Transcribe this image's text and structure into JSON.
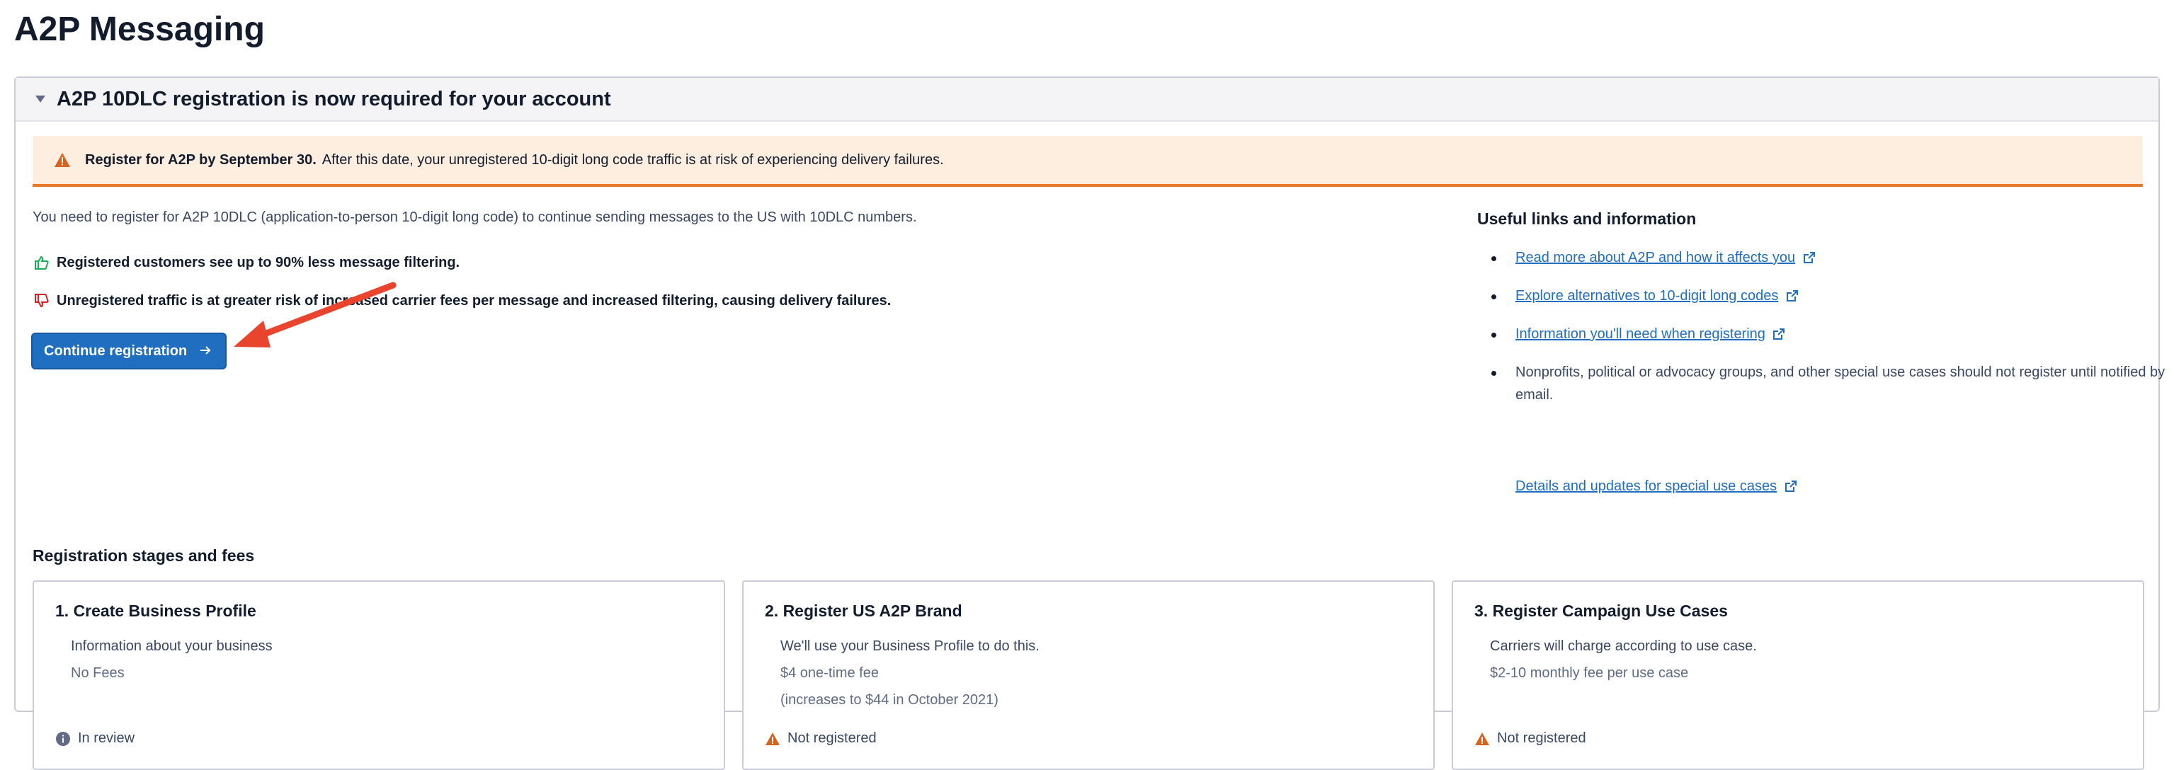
{
  "page": {
    "title": "A2P Messaging"
  },
  "panel": {
    "title": "A2P 10DLC registration is now required for your account"
  },
  "alert": {
    "bold": "Register for A2P by September 30.",
    "text": "After this date, your unregistered 10-digit long code traffic is at risk of experiencing delivery failures."
  },
  "intro": "You need to register for A2P 10DLC (application-to-person 10-digit long code) to continue sending messages to the US with 10DLC numbers.",
  "pro": "Registered customers see up to 90% less message filtering.",
  "con": "Unregistered traffic is at greater risk of increased carrier fees per message and increased filtering, causing delivery failures.",
  "continue_button": {
    "label": "Continue registration",
    "icon": "arrow-right-icon"
  },
  "links": {
    "title": "Useful links and information",
    "items": [
      {
        "label": "Read more about A2P and how it affects you"
      },
      {
        "label": "Explore alternatives to 10-digit long codes"
      },
      {
        "label": "Information you'll need when registering"
      }
    ],
    "note": "Nonprofits, political or advocacy groups, and other special use cases should not register until notified by email.",
    "note_link": "Details and updates for special use cases"
  },
  "stages": {
    "title": "Registration stages and fees",
    "cards": [
      {
        "title": "1. Create Business Profile",
        "desc": "Information about your business",
        "fee": "No Fees",
        "fee2": "",
        "status": "In review",
        "status_icon": "info-icon"
      },
      {
        "title": "2. Register US A2P Brand",
        "desc": "We'll use your Business Profile to do this.",
        "fee": "$4 one-time fee",
        "fee2": "(increases to $44 in October 2021)",
        "status": "Not registered",
        "status_icon": "warning-icon"
      },
      {
        "title": "3. Register Campaign Use Cases",
        "desc": "Carriers will charge according to use case.",
        "fee": "$2-10 monthly fee per use case",
        "fee2": "",
        "status": "Not registered",
        "status_icon": "warning-icon"
      }
    ]
  },
  "colors": {
    "accent": "#1f6ebf",
    "warning": "#e8792b",
    "alert_bg": "#fdeee0",
    "annotation_arrow": "#e8442e"
  }
}
